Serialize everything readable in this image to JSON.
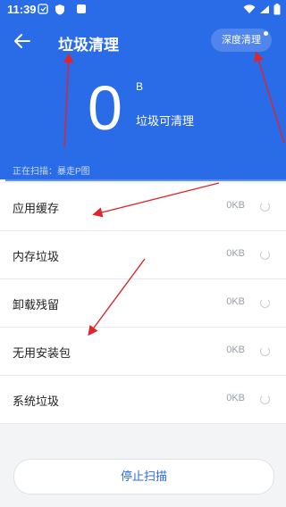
{
  "status_bar": {
    "time": "11:39"
  },
  "header": {
    "title": "垃圾清理",
    "deep_clean_label": "深度清理",
    "junk_value": "0",
    "junk_unit": "B",
    "junk_caption": "垃圾可清理",
    "scanning_text": "正在扫描：暴走P图",
    "scan_progress_percent": 2
  },
  "list": [
    {
      "label": "应用缓存",
      "size": "0KB"
    },
    {
      "label": "内存垃圾",
      "size": "0KB"
    },
    {
      "label": "卸载残留",
      "size": "0KB"
    },
    {
      "label": "无用安装包",
      "size": "0KB"
    },
    {
      "label": "系统垃圾",
      "size": "0KB"
    }
  ],
  "stop_button_label": "停止扫描",
  "colors": {
    "primary": "#2a6be8",
    "annotation_arrow": "#e0242b"
  }
}
